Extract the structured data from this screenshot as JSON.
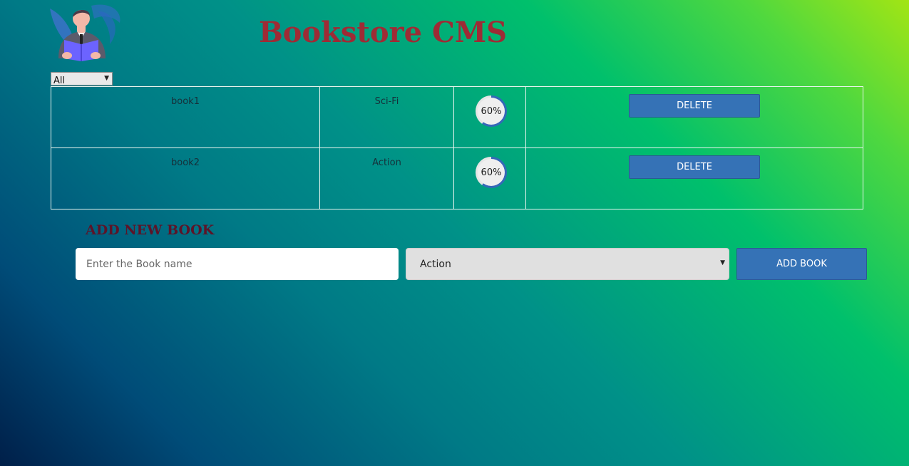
{
  "header": {
    "title": "Bookstore CMS",
    "logo_icon": "person-reading-book-icon"
  },
  "filter": {
    "selected": "All"
  },
  "books": [
    {
      "name": "book1",
      "category": "Sci-Fi",
      "progress_label": "60%",
      "progress_percent": 60,
      "delete_label": "DELETE"
    },
    {
      "name": "book2",
      "category": "Action",
      "progress_label": "60%",
      "progress_percent": 60,
      "delete_label": "DELETE"
    }
  ],
  "add_form": {
    "title": "ADD NEW BOOK",
    "name_placeholder": "Enter the Book name",
    "category_selected": "Action",
    "submit_label": "ADD BOOK"
  },
  "colors": {
    "title": "#9e2b35",
    "form_title": "#5c1428",
    "button": "#3572b6",
    "progress_ring": "#3568b8"
  }
}
